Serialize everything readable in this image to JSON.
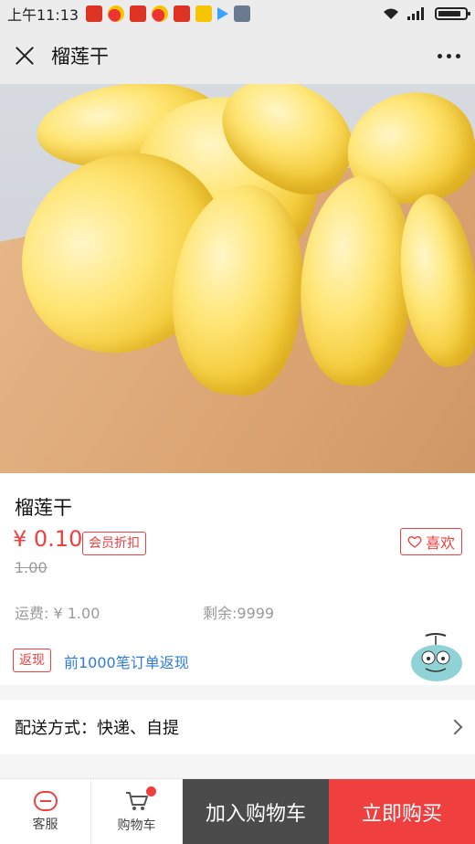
{
  "status_bar": {
    "time": "上午11:13",
    "notification_icons": [
      "netease-news-icon",
      "weibo-icon",
      "netease-news-icon",
      "weibo-icon",
      "netease-news-icon",
      "app-icon",
      "play-icon",
      "calculator-icon"
    ]
  },
  "header": {
    "title": "榴莲干",
    "close_icon": "close-icon",
    "more_icon": "more-icon"
  },
  "product": {
    "name": "榴莲干",
    "price": "¥ 0.10",
    "member_badge": "会员折扣",
    "original_price": "1.00",
    "like_label": "喜欢",
    "shipping": "运费: ¥ 1.00",
    "stock": "剩余:9999",
    "rebate_tag": "返现",
    "rebate_text": "前1000笔订单返现"
  },
  "delivery": {
    "label": "配送方式：快递、自提"
  },
  "bottom_bar": {
    "service_label": "客服",
    "cart_label": "购物车",
    "add_to_cart": "加入购物车",
    "buy_now": "立即购买"
  },
  "colors": {
    "accent": "#ef3f3f",
    "link": "#2f7bd6",
    "dark_button": "#4b4b4b"
  }
}
